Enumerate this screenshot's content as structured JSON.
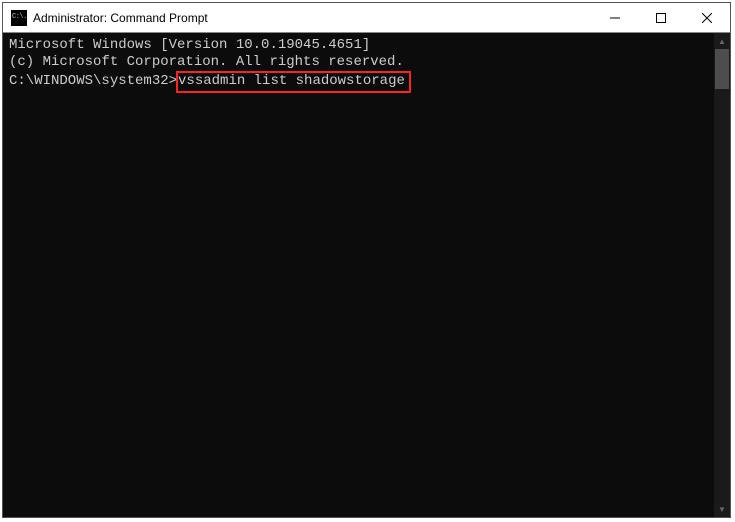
{
  "window": {
    "title": "Administrator: Command Prompt",
    "icon_text": "C:\\."
  },
  "terminal": {
    "line1": "Microsoft Windows [Version 10.0.19045.4651]",
    "line2": "(c) Microsoft Corporation. All rights reserved.",
    "blank": "",
    "prompt": "C:\\WINDOWS\\system32>",
    "command": "vssadmin list shadowstorage"
  }
}
